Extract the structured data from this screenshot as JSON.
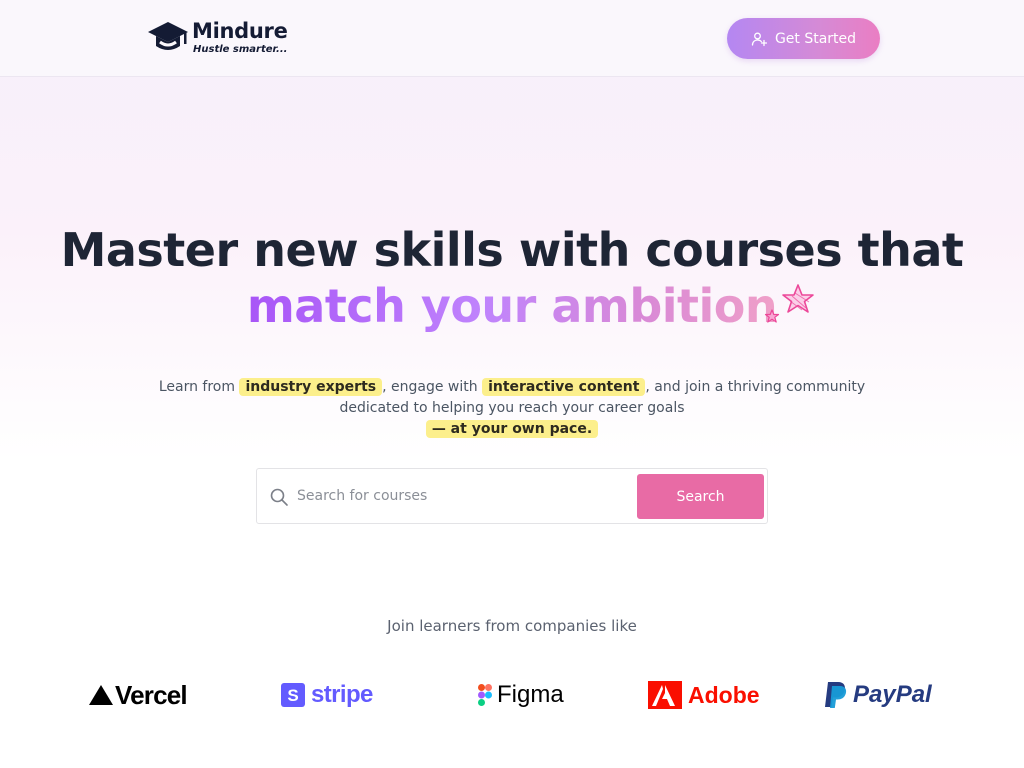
{
  "brand": {
    "name": "Mindure",
    "tagline": "Hustle smarter..."
  },
  "header": {
    "cta_label": "Get Started"
  },
  "hero": {
    "headline_line1": "Master new skills with courses that",
    "headline_line2": "match your ambition",
    "sub_part1": "Learn from ",
    "sub_hl1": "industry experts",
    "sub_part2": ", engage with ",
    "sub_hl2": "interactive content",
    "sub_part3": ", and join a thriving community",
    "sub_line2": "dedicated to helping you reach your career goals",
    "sub_hl3": "— at your own pace."
  },
  "search": {
    "placeholder": "Search for courses",
    "button_label": "Search"
  },
  "companies": {
    "heading": "Join learners from companies like",
    "items": [
      {
        "name": "Vercel",
        "icon": "vercel-triangle-icon"
      },
      {
        "name": "stripe",
        "icon": "stripe-s-icon"
      },
      {
        "name": "Figma",
        "icon": "figma-icon"
      },
      {
        "name": "Adobe",
        "icon": "adobe-icon"
      },
      {
        "name": "PayPal",
        "icon": "paypal-icon"
      }
    ]
  },
  "colors": {
    "accent_gradient_start": "#b487f2",
    "accent_gradient_end": "#ea7ec3",
    "search_button": "#e86ba5",
    "highlight": "#fcef8c",
    "heading_dark": "#1e2535"
  }
}
